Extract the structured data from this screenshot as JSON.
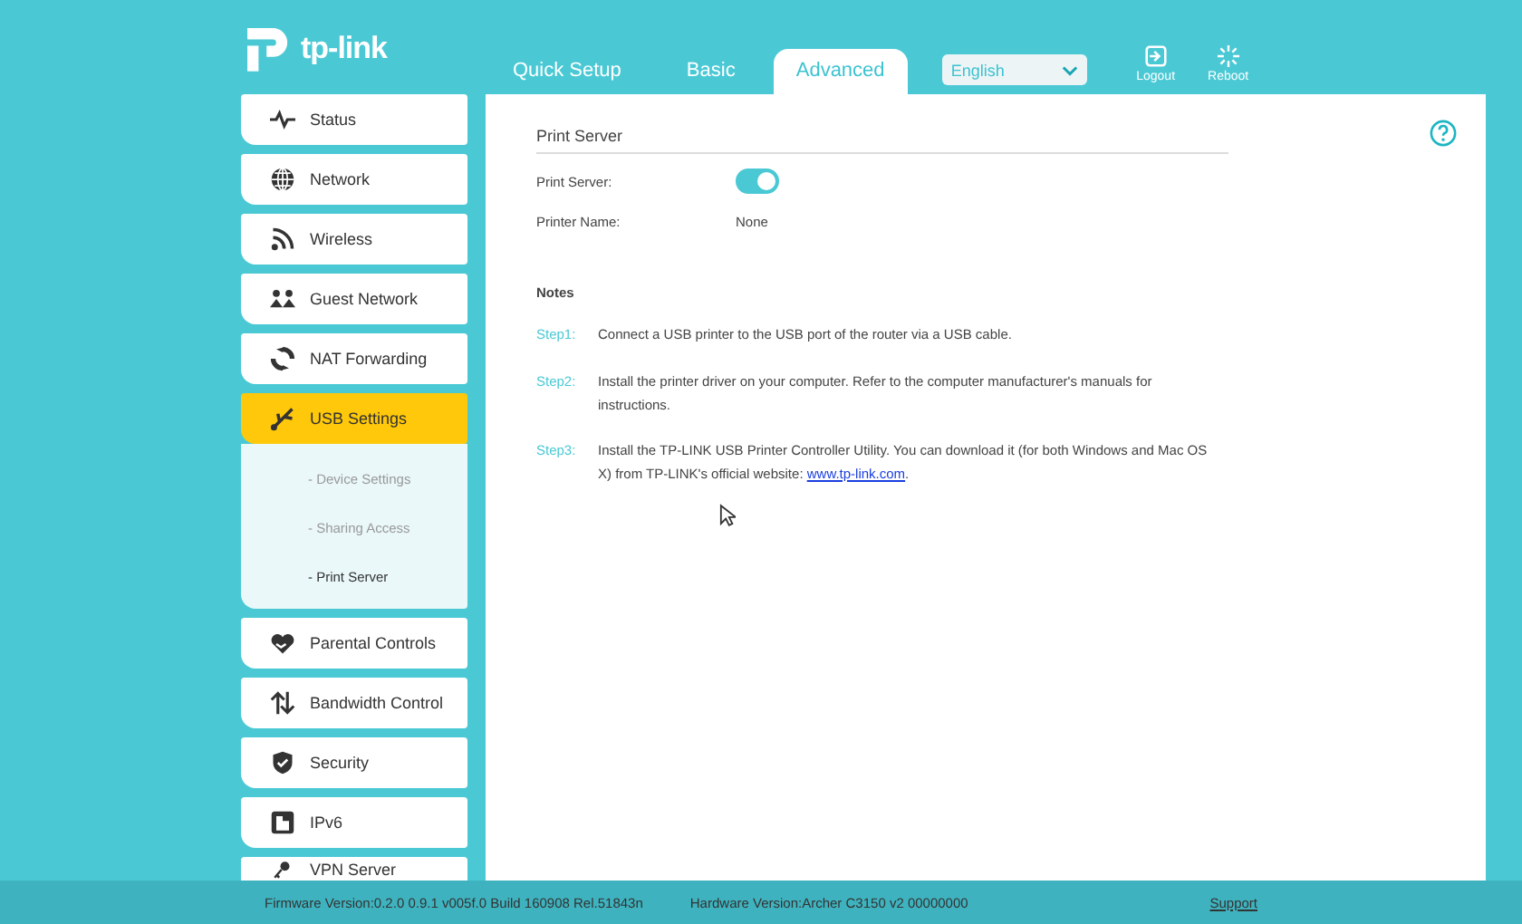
{
  "logo": {
    "text": "tp-link"
  },
  "nav_tabs": [
    {
      "label": "Quick Setup",
      "selected": false
    },
    {
      "label": "Basic",
      "selected": false
    },
    {
      "label": "Advanced",
      "selected": true
    }
  ],
  "language": {
    "value": "English"
  },
  "header_buttons": [
    {
      "kind": "logout",
      "label": "Logout"
    },
    {
      "kind": "reboot",
      "label": "Reboot"
    }
  ],
  "sidebar": {
    "items": [
      {
        "label": "Status",
        "selected": false
      },
      {
        "label": "Network",
        "selected": false
      },
      {
        "label": "Wireless",
        "selected": false
      },
      {
        "label": "Guest Network",
        "selected": false
      },
      {
        "label": "NAT Forwarding",
        "selected": false
      },
      {
        "label": "USB Settings",
        "selected": true,
        "expanded": true,
        "children": [
          {
            "label": "- Device Settings",
            "selected": false
          },
          {
            "label": "- Sharing Access",
            "selected": false
          },
          {
            "label": "- Print Server",
            "selected": true
          }
        ]
      },
      {
        "label": "Parental Controls",
        "selected": false
      },
      {
        "label": "Bandwidth Control",
        "selected": false
      },
      {
        "label": "Security",
        "selected": false
      },
      {
        "label": "IPv6",
        "selected": false
      },
      {
        "label": "VPN Server",
        "selected": false
      }
    ]
  },
  "panel": {
    "title": "Print Server",
    "fields": [
      {
        "kind": "toggle",
        "label": "Print Server:",
        "on": true
      },
      {
        "kind": "text",
        "label": "Printer Name:",
        "value": "None"
      }
    ],
    "notes_title": "Notes",
    "steps": [
      {
        "label": "Step1:",
        "text": "Connect a USB printer to the USB port of the router via a USB cable."
      },
      {
        "label": "Step2:",
        "text": "Install the printer driver on your computer. Refer to the computer manufacturer's manuals for instructions."
      },
      {
        "label": "Step3:",
        "text": "Install the TP-LINK USB Printer Controller Utility. You can download it (for both Windows and Mac OS X) from TP-LINK's official website: ",
        "link": "www.tp-link.com",
        "after": "."
      }
    ]
  },
  "footer": {
    "firmware": "Firmware Version:0.2.0 0.9.1 v005f.0 Build 160908 Rel.51843n",
    "hardware": "Hardware Version:Archer C3150 v2 00000000",
    "support": "Support"
  }
}
